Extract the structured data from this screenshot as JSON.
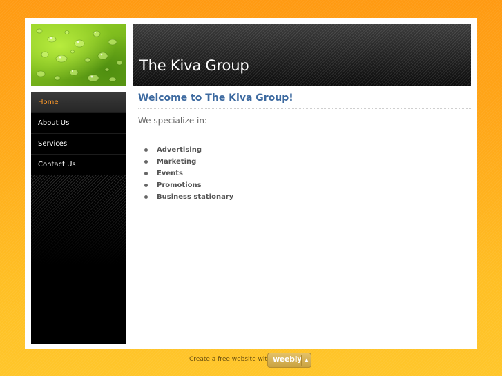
{
  "header": {
    "site_title": "The Kiva Group",
    "leaf_image": "leaf-with-water-drops"
  },
  "sidebar": {
    "items": [
      {
        "label": "Home",
        "active": true
      },
      {
        "label": "About Us",
        "active": false
      },
      {
        "label": "Services",
        "active": false
      },
      {
        "label": "Contact Us",
        "active": false
      }
    ]
  },
  "main": {
    "heading": "Welcome to The Kiva Group!",
    "intro": "We specialize in:",
    "services": [
      "Advertising",
      "Marketing",
      "Events",
      "Promotions",
      "Business stationary"
    ]
  },
  "footer": {
    "text": "Create a free website with",
    "badge_label": "weebly",
    "badge_icon": "chevron-up-icon"
  },
  "colors": {
    "accent_orange": "#ff9a2a",
    "heading_blue": "#3d6aa0",
    "page_background": "#ffbe24"
  }
}
